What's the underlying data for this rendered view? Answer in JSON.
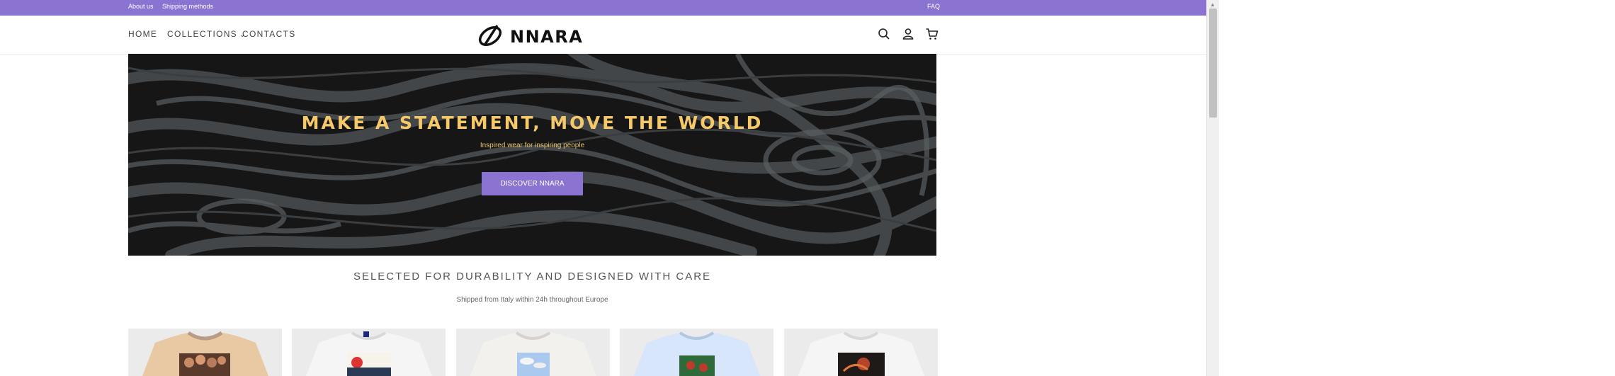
{
  "announcement": {
    "about": "About us",
    "shipping": "Shipping methods",
    "faq": "FAQ",
    "bg_color": "#8a73d1"
  },
  "nav": {
    "home": "HOME",
    "collections": "COLLECTIONS",
    "contacts": "CONTACTS"
  },
  "logo": {
    "text": "NNARA"
  },
  "header_icons": [
    "search-icon",
    "account-icon",
    "cart-icon"
  ],
  "hero": {
    "title": "MAKE A STATEMENT, MOVE THE WORLD",
    "subtitle": "Inspired wear for inspiring people",
    "button": "DISCOVER NNARA",
    "title_color": "#f5c96a",
    "button_color": "#8a73d1"
  },
  "section": {
    "title": "SELECTED FOR DURABILITY AND DESIGNED WITH CARE",
    "subtitle": "Shipped from Italy within 24h throughout Europe"
  },
  "products": [
    {
      "shirt_color": "#e8c9a3",
      "print": "group-photo"
    },
    {
      "shirt_color": "#f5f5f5",
      "print": "red-sun-landscape"
    },
    {
      "shirt_color": "#f3f1ee",
      "print": "sky-clouds"
    },
    {
      "shirt_color": "#d7e6fb",
      "print": "green-red-figure"
    },
    {
      "shirt_color": "#f5f5f5",
      "print": "dark-scene"
    }
  ]
}
